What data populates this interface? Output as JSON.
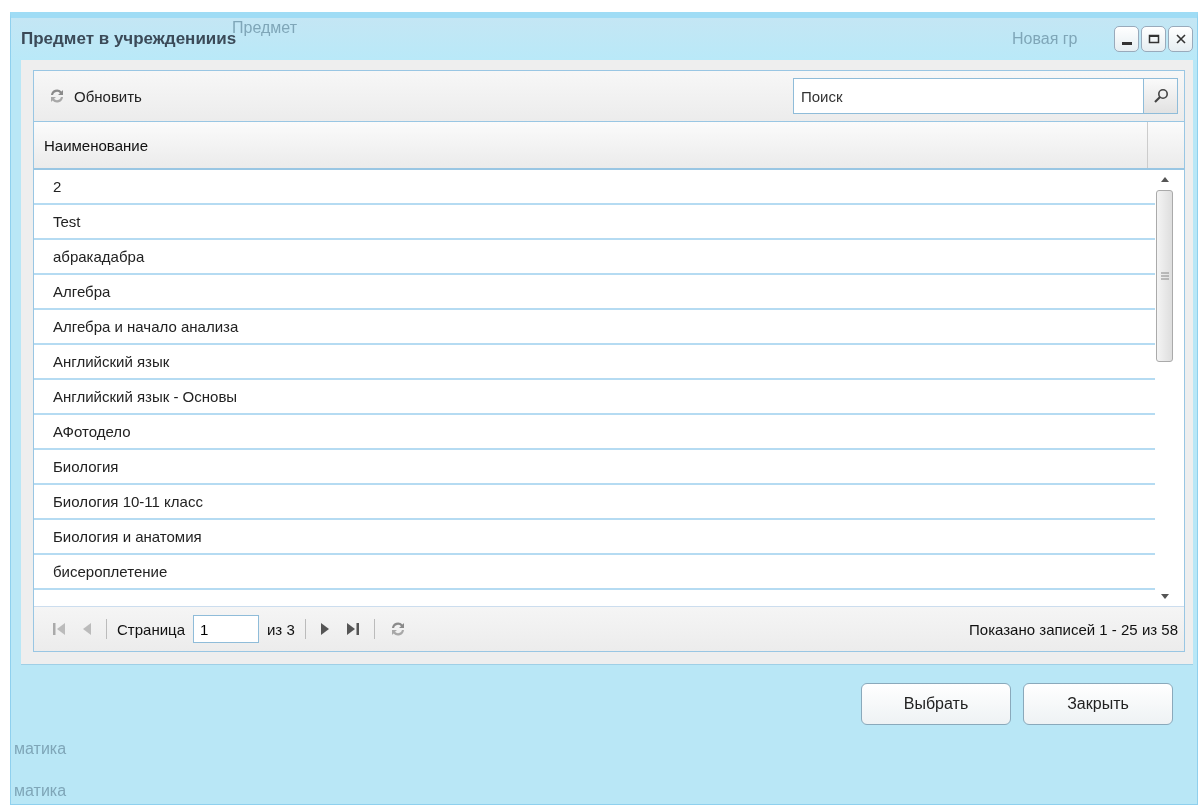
{
  "background_texts": [
    "Предмет",
    "Новая гр",
    "матика",
    "матика"
  ],
  "window": {
    "title": "Предмет в учреждениииs"
  },
  "toolbar": {
    "refresh_label": "Обновить",
    "search": {
      "placeholder": "Поиск"
    }
  },
  "table": {
    "columns": [
      "Наименование"
    ],
    "rows": [
      {
        "name": "2"
      },
      {
        "name": "Test"
      },
      {
        "name": "абракадабра"
      },
      {
        "name": "Алгебра"
      },
      {
        "name": "Алгебра и начало анализа"
      },
      {
        "name": "Английский язык"
      },
      {
        "name": "Английский язык - Основы"
      },
      {
        "name": "АФотодело"
      },
      {
        "name": "Биология"
      },
      {
        "name": "Биология 10-11 класс"
      },
      {
        "name": "Биология и анатомия"
      },
      {
        "name": "бисероплетение"
      }
    ]
  },
  "paging": {
    "page_label": "Страница",
    "page": "1",
    "of_label": "из 3",
    "summary": "Показано записей 1 - 25 из 58"
  },
  "buttons": [
    "Выбрать",
    "Закрыть"
  ]
}
